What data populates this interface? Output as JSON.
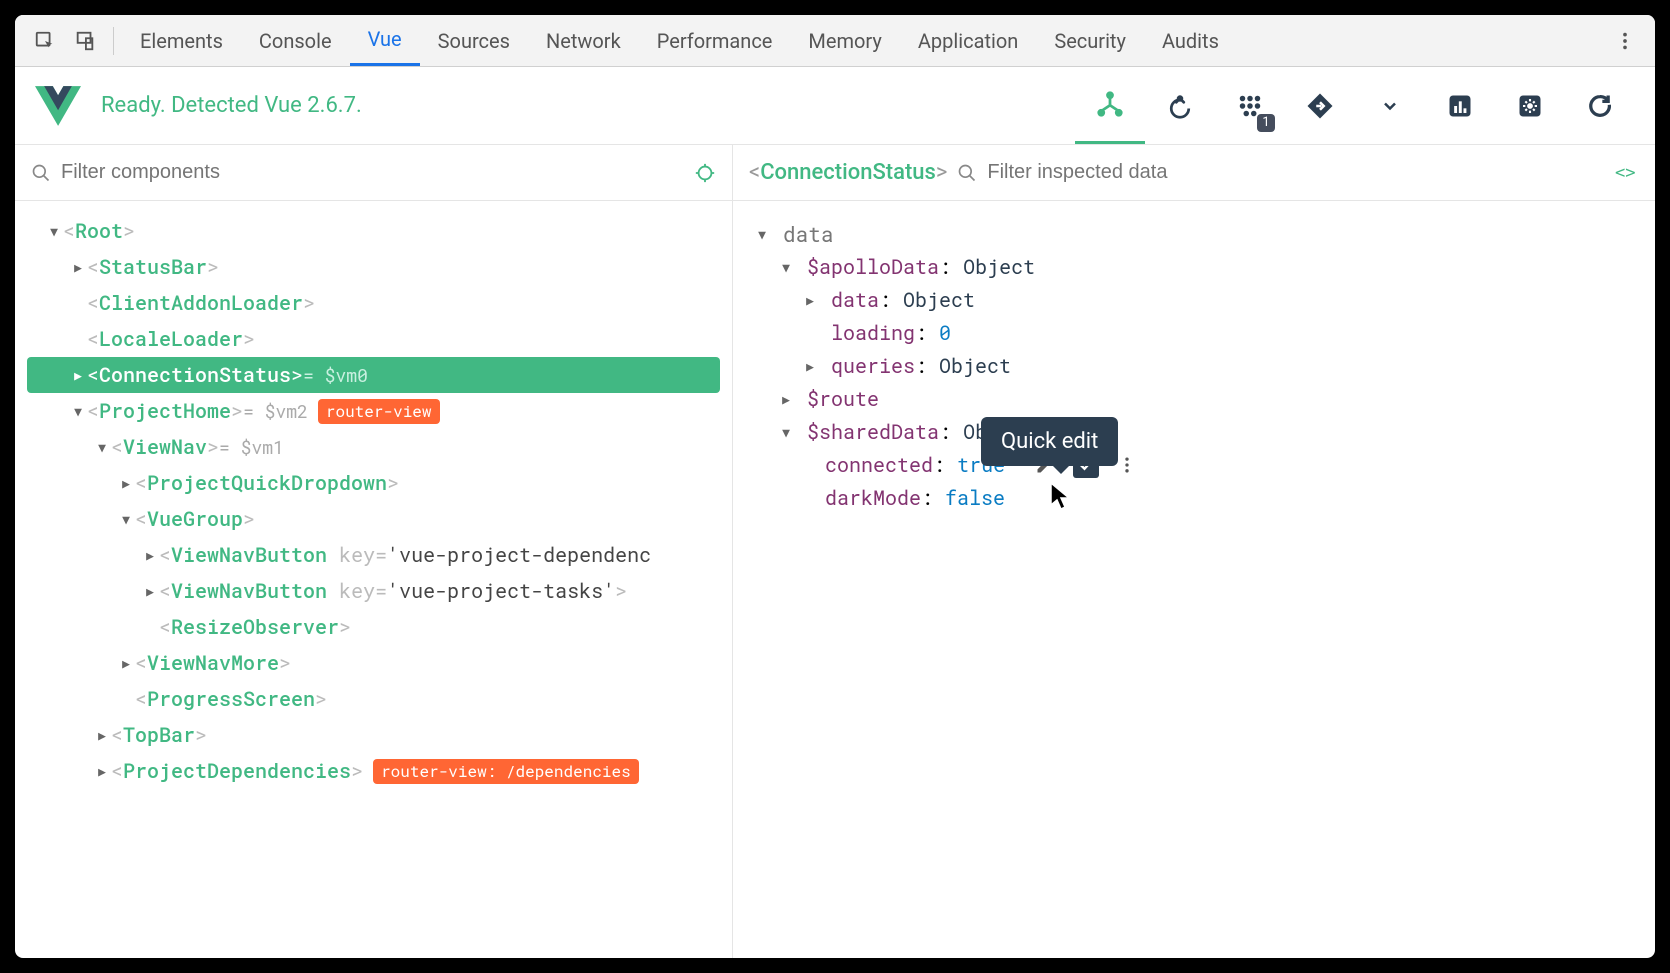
{
  "devtools_tabs": {
    "elements": "Elements",
    "console": "Console",
    "vue": "Vue",
    "sources": "Sources",
    "network": "Network",
    "performance": "Performance",
    "memory": "Memory",
    "application": "Application",
    "security": "Security",
    "audits": "Audits"
  },
  "vue_header": {
    "status": "Ready. Detected Vue 2.6.7.",
    "events_badge": "1"
  },
  "left": {
    "filter_placeholder": "Filter components"
  },
  "right": {
    "selected_component": "ConnectionStatus",
    "filter_placeholder": "Filter inspected data"
  },
  "tooltip": "Quick edit",
  "tree": {
    "root": "Root",
    "status_bar": "StatusBar",
    "client_addon": "ClientAddonLoader",
    "locale_loader": "LocaleLoader",
    "connection_status": "ConnectionStatus",
    "conn_suffix": " = $vm0",
    "project_home": "ProjectHome",
    "project_home_suffix": " = $vm2",
    "project_home_tag": "router-view",
    "view_nav": "ViewNav",
    "view_nav_suffix": " = $vm1",
    "project_quick": "ProjectQuickDropdown",
    "vue_group": "VueGroup",
    "view_nav_button": "ViewNavButton",
    "vnb1_attr_k": "key",
    "vnb1_attr_v": "'vue-project-dependenc",
    "vnb2_attr_k": "key",
    "vnb2_attr_v": "'vue-project-tasks'",
    "resize_observer": "ResizeObserver",
    "view_nav_more": "ViewNavMore",
    "progress_screen": "ProgressScreen",
    "top_bar": "TopBar",
    "project_deps": "ProjectDependencies",
    "project_deps_tag": "router-view: /dependencies"
  },
  "data": {
    "section": "data",
    "apollo_k": "$apolloData",
    "apollo_v": "Object",
    "data_k": "data",
    "data_v": "Object",
    "loading_k": "loading",
    "loading_v": "0",
    "queries_k": "queries",
    "queries_v": "Object",
    "route_k": "$route",
    "shared_k": "$sharedData",
    "shared_v": "Obj",
    "connected_k": "connected",
    "connected_v": "true",
    "dark_k": "darkMode",
    "dark_v": "false"
  }
}
